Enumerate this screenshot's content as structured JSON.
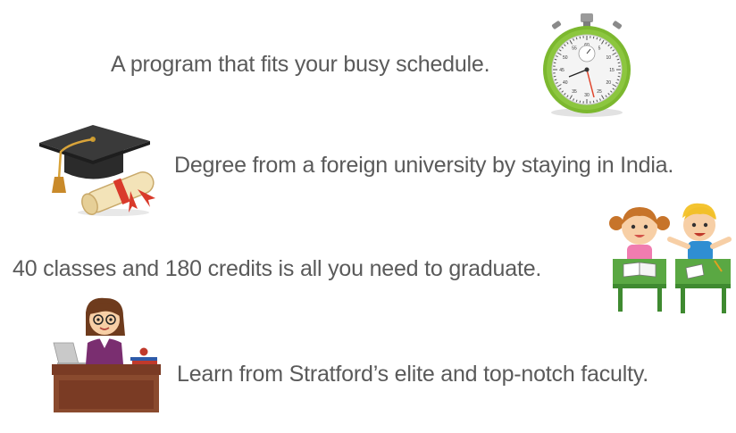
{
  "features": [
    {
      "text": "A program that fits your busy schedule.",
      "icon": "stopwatch-icon"
    },
    {
      "text": "Degree from a foreign university by staying in India.",
      "icon": "graduation-cap-diploma-icon"
    },
    {
      "text": "40 classes and 180 credits is all you need to graduate.",
      "icon": "students-at-desks-icon"
    },
    {
      "text": "Learn from Stratford’s elite and top-notch faculty.",
      "icon": "teacher-at-desk-icon"
    }
  ],
  "stopwatch_numbers": [
    "60",
    "5",
    "10",
    "15",
    "20",
    "25",
    "30",
    "35",
    "40",
    "45",
    "50",
    "55"
  ],
  "colors": {
    "text": "#5a5a5a",
    "stopwatch_green": "#8cc63f",
    "desk_green": "#5aa843",
    "teacher_desk": "#7a3b24"
  }
}
